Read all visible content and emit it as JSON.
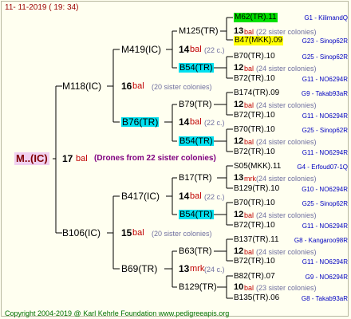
{
  "header": {
    "date": "11-  11-2019  ( 19:  34)"
  },
  "footer": {
    "copyright": "Copyright 2004-2019 @ Karl Kehrle Foundation    www.pedigreeapis.org"
  },
  "queen": {
    "name": "M..(IC)",
    "count": "17",
    "type": "bal",
    "drones_text": "(Drones from 22 sister colonies)"
  },
  "sire": {
    "name": "M118(IC)",
    "mother": {
      "name": "M419(IC)",
      "count": "16",
      "type": "bal",
      "colonies": "(20 sister colonies)",
      "mother": {
        "name": "M125(TR)",
        "count": "14",
        "type": "bal",
        "colonies": "(22 c.)",
        "mother": {
          "name": "M62(TR).11",
          "info": "G1 - KilimandQ"
        },
        "drones": {
          "count": "13",
          "type": "bal",
          "colonies": "(22 sister colonies)"
        },
        "father": {
          "name": "B47(MKK).09",
          "info": "G23 - Sinop62R"
        }
      },
      "father": {
        "name": "B54(TR)",
        "mother": {
          "name": "B70(TR).10",
          "info": "G25 - Sinop62R"
        },
        "drones": {
          "count": "12",
          "type": "bal",
          "colonies": "(24 sister colonies)"
        },
        "father": {
          "name": "B72(TR).10",
          "info": "G11 - NO6294R"
        }
      }
    },
    "father": {
      "name": "B76(TR)",
      "mother": {
        "name": "B79(TR)",
        "count": "14",
        "type": "bal",
        "colonies": "(22 c.)",
        "mother": {
          "name": "B174(TR).09",
          "info": "G9 - Takab93aR"
        },
        "drones": {
          "count": "12",
          "type": "bal",
          "colonies": "(24 sister colonies)"
        },
        "father": {
          "name": "B72(TR).10",
          "info": "G11 - NO6294R"
        }
      },
      "father": {
        "name": "B54(TR)",
        "mother": {
          "name": "B70(TR).10",
          "info": "G25 - Sinop62R"
        },
        "drones": {
          "count": "12",
          "type": "bal",
          "colonies": "(24 sister colonies)"
        },
        "father": {
          "name": "B72(TR).10",
          "info": "G11 - NO6294R"
        }
      }
    }
  },
  "dam": {
    "name": "B106(IC)",
    "mother": {
      "name": "B417(IC)",
      "count": "14",
      "type": "bal",
      "colonies": "(22 c.)",
      "mother": {
        "name": "B17(TR)",
        "count": "13",
        "type": "mrk",
        "colonies": "(24 c.)",
        "mother": {
          "name": "S05(MKK).11",
          "info": "G4 - Erfoud07-1Q"
        },
        "drones": {
          "count": "13",
          "type": "mrk",
          "colonies": "(24 sister colonies)"
        },
        "father": {
          "name": "B129(TR).10",
          "info": "G10 - NO6294R"
        }
      },
      "father": {
        "name": "B54(TR)",
        "mother": {
          "name": "B70(TR).10",
          "info": "G25 - Sinop62R"
        },
        "drones": {
          "count": "12",
          "type": "bal",
          "colonies": "(24 sister colonies)"
        },
        "father": {
          "name": "B72(TR).10",
          "info": "G11 - NO6294R"
        }
      }
    },
    "count": "15",
    "type": "bal",
    "colonies": "(20 sister colonies)",
    "father": {
      "name": "B69(TR)",
      "count": "13",
      "type": "mrk",
      "colonies": "(24 c.)",
      "mother": {
        "name": "B63(TR)",
        "mother": {
          "name": "B137(TR).11",
          "info": "G8 - Kangaroo98R"
        },
        "drones": {
          "count": "12",
          "type": "bal",
          "colonies": "(24 sister colonies)"
        },
        "father": {
          "name": "B72(TR).10",
          "info": "G11 - NO6294R"
        }
      },
      "father": {
        "name": "B129(TR)",
        "mother": {
          "name": "B82(TR).07",
          "info": "G9 - NO6294R"
        },
        "drones": {
          "count": "10",
          "type": "bal",
          "colonies": "(23 sister colonies)"
        },
        "father": {
          "name": "B135(TR).06",
          "info": "G8 - Takab93aR"
        }
      }
    }
  },
  "colors": {
    "background": "#fffff0",
    "lines": "#000000",
    "type_red": "#c00000",
    "info_blue": "#0000c0",
    "queen_bg": "#f0d0f0",
    "highlight_cyan": "#00e0f0",
    "highlight_green": "#00e000",
    "highlight_yellow": "#ffff00"
  }
}
